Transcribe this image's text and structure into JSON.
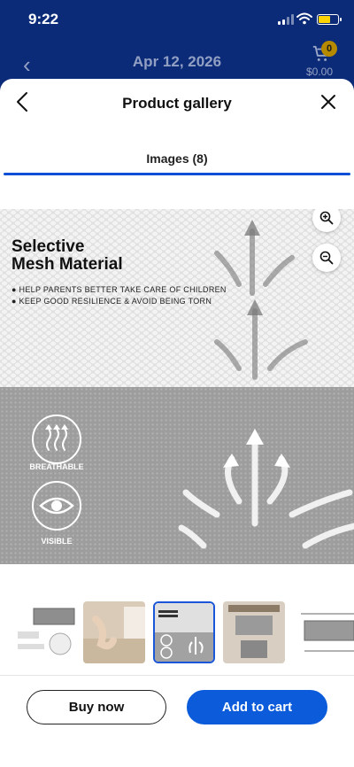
{
  "status_bar": {
    "time": "9:22"
  },
  "background_header": {
    "date": "Apr 12, 2026",
    "cart_count": "0",
    "cart_total": "$0.00"
  },
  "sheet": {
    "title": "Product gallery",
    "tab_label": "Images (8)"
  },
  "main_image": {
    "title_line1": "Selective",
    "title_line2": "Mesh Material",
    "bullet1": "● HELP PARENTS BETTER TAKE CARE OF CHILDREN",
    "bullet2": "● KEEP GOOD RESILIENCE & AVOID BEING TORN",
    "feature1": "BREATHABLE",
    "feature2": "VISIBLE"
  },
  "thumbnails": {
    "count": 5,
    "selected_index": 2
  },
  "footer": {
    "buy_now": "Buy now",
    "add_to_cart": "Add to cart"
  },
  "colors": {
    "brand_blue": "#0b2a78",
    "accent_blue": "#0b5bdb",
    "badge_yellow": "#ffd400"
  }
}
